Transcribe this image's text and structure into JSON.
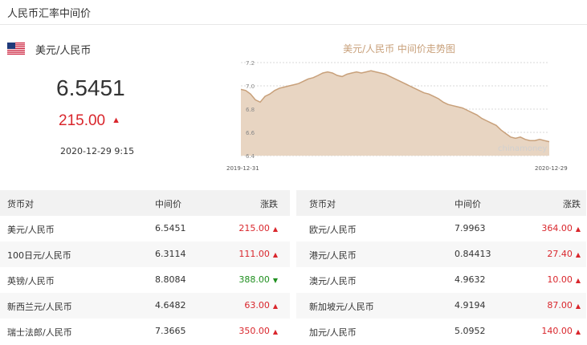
{
  "header": {
    "title": "人民币汇率中间价"
  },
  "featured": {
    "pair": "美元/人民币",
    "rate": "6.5451",
    "change": "215.00",
    "change_icon": "▲",
    "datetime": "2020-12-29 9:15"
  },
  "chart": {
    "title": "美元/人民币 中间价走势图",
    "watermark": "chinamoney",
    "yticks": [
      "7.2",
      "7.0",
      "6.8",
      "6.6",
      "6.4"
    ],
    "x_start": "2019-12-31",
    "x_end": "2020-12-29"
  },
  "chart_data": {
    "type": "area",
    "ylim": [
      6.4,
      7.2
    ],
    "x": [
      "2019-12-31",
      "2020-12-29"
    ],
    "values": [
      6.97,
      6.96,
      6.93,
      6.88,
      6.86,
      6.91,
      6.93,
      6.96,
      6.98,
      6.99,
      7.0,
      7.01,
      7.02,
      7.04,
      7.06,
      7.07,
      7.09,
      7.11,
      7.12,
      7.11,
      7.09,
      7.08,
      7.1,
      7.11,
      7.12,
      7.11,
      7.12,
      7.13,
      7.12,
      7.11,
      7.1,
      7.08,
      7.06,
      7.04,
      7.02,
      7.0,
      6.98,
      6.96,
      6.94,
      6.93,
      6.91,
      6.89,
      6.86,
      6.84,
      6.83,
      6.82,
      6.81,
      6.79,
      6.77,
      6.75,
      6.72,
      6.7,
      6.68,
      6.66,
      6.62,
      6.59,
      6.56,
      6.55,
      6.56,
      6.54,
      6.53,
      6.53,
      6.54,
      6.53,
      6.52
    ]
  },
  "tables": {
    "headers": {
      "pair": "货币对",
      "mid": "中间价",
      "change": "涨跌"
    },
    "left": [
      {
        "pair": "美元/人民币",
        "mid": "6.5451",
        "change": "215.00",
        "dir": "▲"
      },
      {
        "pair": "100日元/人民币",
        "mid": "6.3114",
        "change": "111.00",
        "dir": "▲"
      },
      {
        "pair": "英镑/人民币",
        "mid": "8.8084",
        "change": "388.00",
        "dir": "▼"
      },
      {
        "pair": "新西兰元/人民币",
        "mid": "4.6482",
        "change": "63.00",
        "dir": "▲"
      },
      {
        "pair": "瑞士法郎/人民币",
        "mid": "7.3665",
        "change": "350.00",
        "dir": "▲"
      }
    ],
    "right": [
      {
        "pair": "欧元/人民币",
        "mid": "7.9963",
        "change": "364.00",
        "dir": "▲"
      },
      {
        "pair": "港元/人民币",
        "mid": "0.84413",
        "change": "27.40",
        "dir": "▲"
      },
      {
        "pair": "澳元/人民币",
        "mid": "4.9632",
        "change": "10.00",
        "dir": "▲"
      },
      {
        "pair": "新加坡元/人民币",
        "mid": "4.9194",
        "change": "87.00",
        "dir": "▲"
      },
      {
        "pair": "加元/人民币",
        "mid": "5.0952",
        "change": "140.00",
        "dir": "▲"
      }
    ]
  },
  "colors": {
    "up": "#d9262c",
    "down": "#1f8f1f",
    "area_line": "#c8a07a",
    "area_fill": "#e8d5c2"
  }
}
